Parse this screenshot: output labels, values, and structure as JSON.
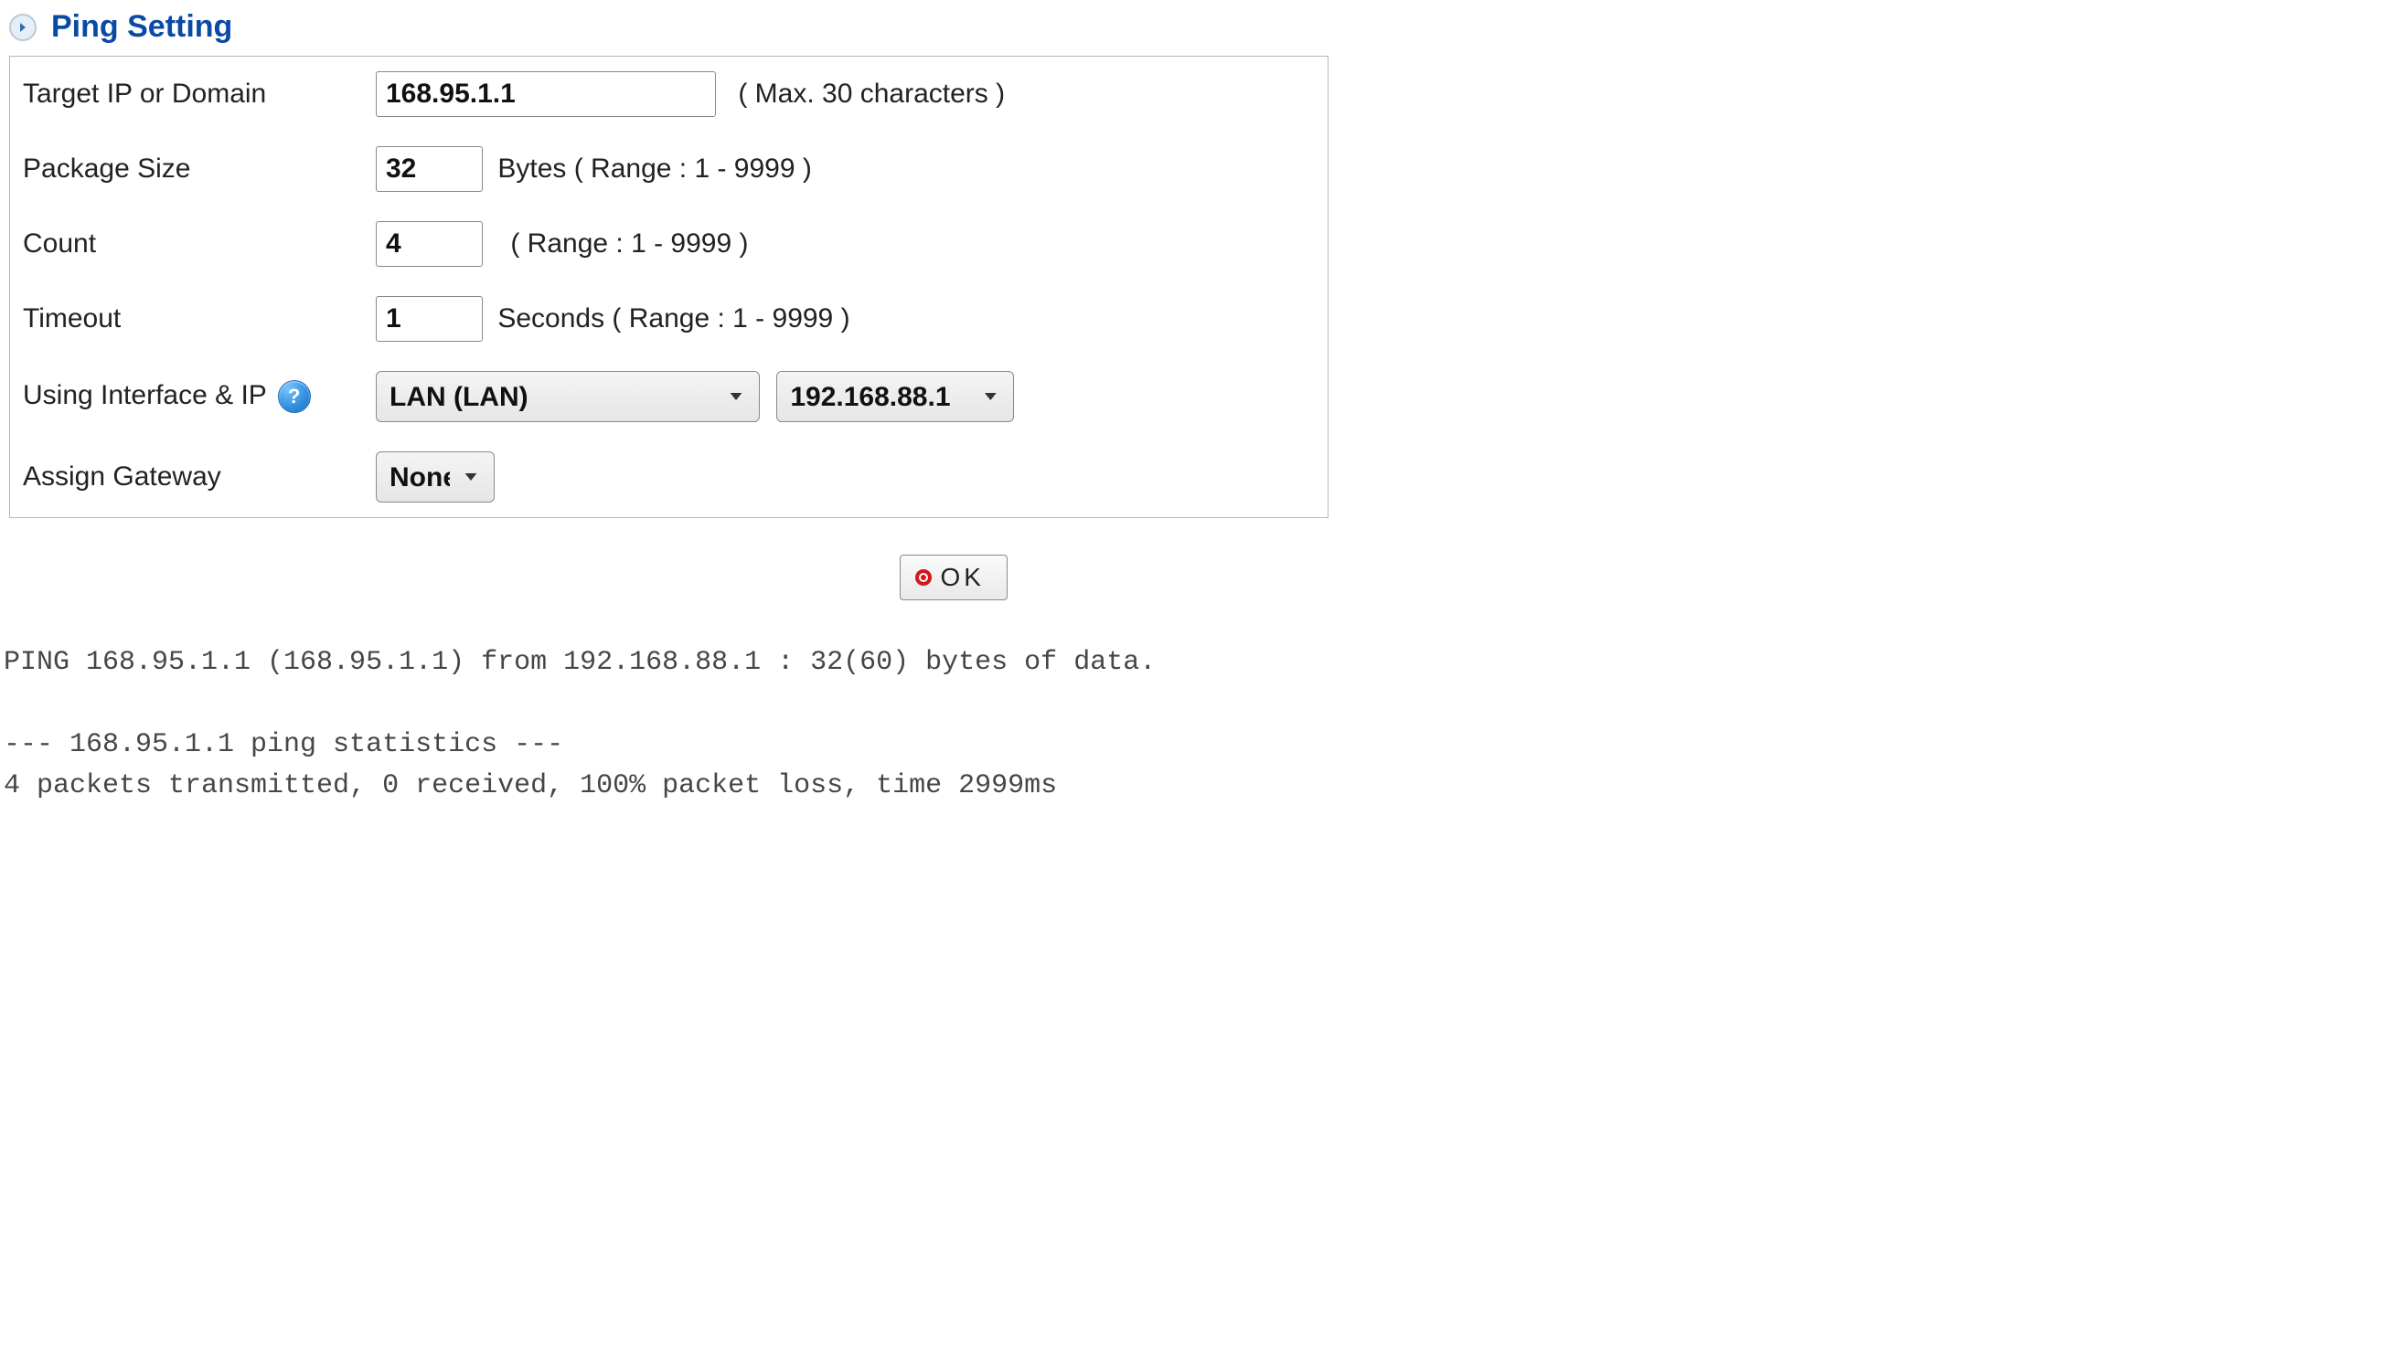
{
  "panel": {
    "title": "Ping Setting"
  },
  "labels": {
    "target": "Target IP or Domain",
    "pkg": "Package Size",
    "count": "Count",
    "timeout": "Timeout",
    "iface": "Using Interface & IP",
    "gateway": "Assign Gateway"
  },
  "hints": {
    "target": "( Max. 30 characters )",
    "pkg": "Bytes  ( Range : 1 - 9999 )",
    "count": "( Range : 1 - 9999 )",
    "timeout": "Seconds  ( Range : 1 - 9999 )"
  },
  "values": {
    "target": "168.95.1.1",
    "pkg": "32",
    "count": "4",
    "timeout": "1",
    "iface": "LAN (LAN)",
    "ip": "192.168.88.1",
    "gateway": "None"
  },
  "help_symbol": "?",
  "buttons": {
    "ok": "OK"
  },
  "output": "PING 168.95.1.1 (168.95.1.1) from 192.168.88.1 : 32(60) bytes of data.\n\n--- 168.95.1.1 ping statistics ---\n4 packets transmitted, 0 received, 100% packet loss, time 2999ms"
}
